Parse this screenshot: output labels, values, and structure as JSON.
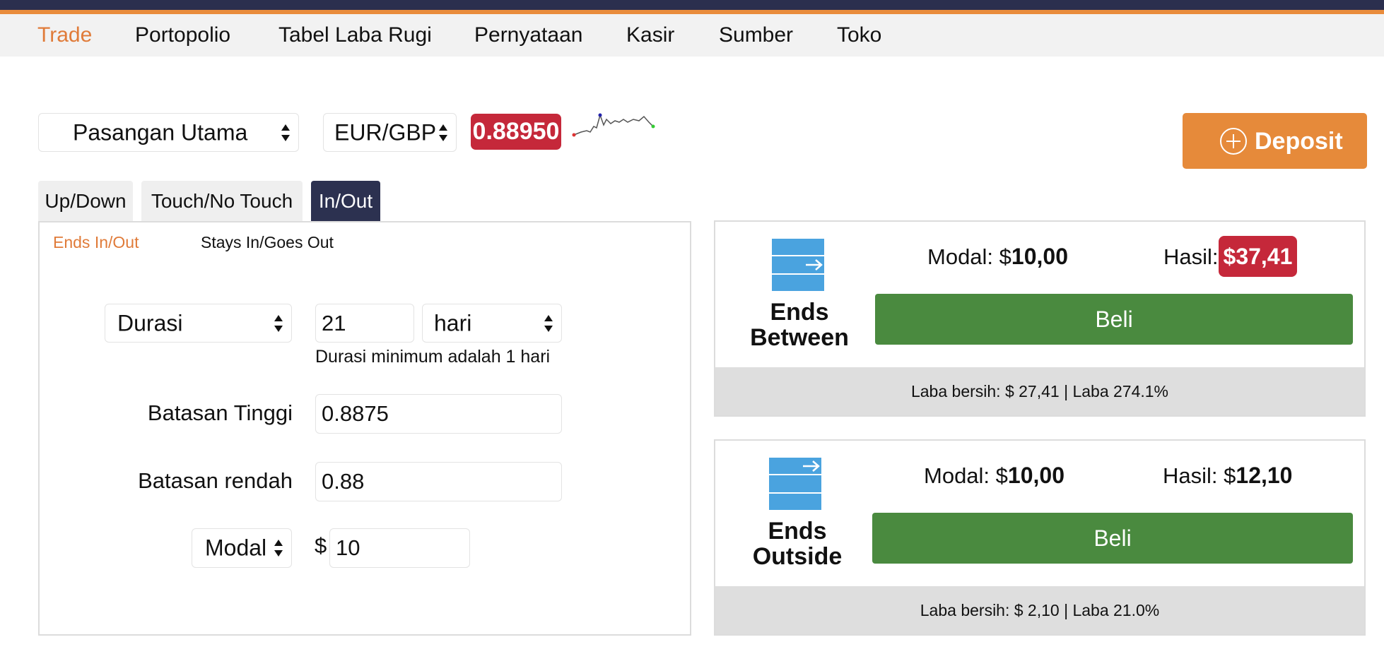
{
  "nav": {
    "items": [
      {
        "label": "Trade",
        "active": true
      },
      {
        "label": "Portopolio"
      },
      {
        "label": "Tabel Laba Rugi"
      },
      {
        "label": "Pernyataan"
      },
      {
        "label": "Kasir"
      },
      {
        "label": "Sumber"
      },
      {
        "label": "Toko"
      }
    ]
  },
  "market": {
    "group_select": "Pasangan Utama",
    "pair_select": "EUR/GBP",
    "price": "0.88950",
    "price_color": "#c5283a"
  },
  "deposit": {
    "label": "Deposit",
    "icon": "plus-circle-icon"
  },
  "tabs": [
    {
      "label": "Up/Down"
    },
    {
      "label": "Touch/No Touch"
    },
    {
      "label": "In/Out",
      "active": true
    }
  ],
  "subtabs": [
    {
      "label": "Ends In/Out",
      "active": true
    },
    {
      "label": "Stays In/Goes Out"
    }
  ],
  "form": {
    "duration_select": "Durasi",
    "duration_value": "21",
    "duration_unit": "hari",
    "duration_hint": "Durasi minimum adalah 1 hari",
    "high_barrier_label": "Batasan Tinggi",
    "high_barrier_value": "0.8875",
    "low_barrier_label": "Batasan rendah",
    "low_barrier_value": "0.88",
    "amount_type": "Modal",
    "currency_symbol": "$",
    "amount_value": "10"
  },
  "contracts": [
    {
      "title_line1": "Ends",
      "title_line2": "Between",
      "stake_label": "Modal:",
      "stake_currency": "$",
      "stake_amount": "10,00",
      "payout_label": "Hasil:",
      "payout_value": "$37,41",
      "buy_label": "Beli",
      "footer": "Laba bersih: $ 27,41 | Laba 274.1%"
    },
    {
      "title_line1": "Ends",
      "title_line2": "Outside",
      "stake_label": "Modal:",
      "stake_currency": "$",
      "stake_amount": "10,00",
      "payout_label": "Hasil:",
      "payout_currency": "$",
      "payout_amount": "12,10",
      "buy_label": "Beli",
      "footer": "Laba bersih: $ 2,10 | Laba 21.0%"
    }
  ],
  "colors": {
    "accent_orange": "#e07b39",
    "nav_dark": "#2b2f4e",
    "buy_green": "#4a8a3f",
    "icon_blue": "#4aa3df"
  }
}
